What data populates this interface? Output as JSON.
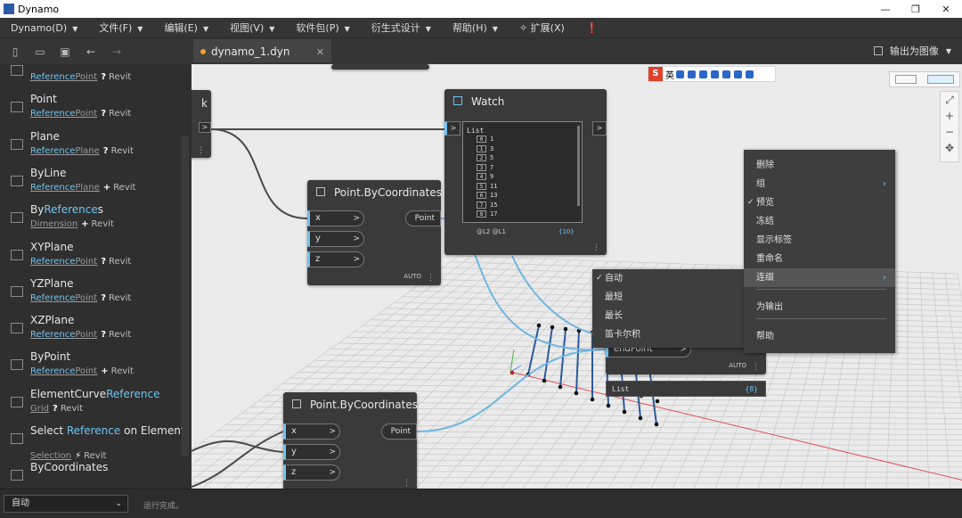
{
  "window": {
    "title": "Dynamo",
    "minimize": "—",
    "restore": "❐",
    "close": "✕"
  },
  "menubar": [
    {
      "label": "Dynamo(D)",
      "arrow": "▼"
    },
    {
      "label": "文件(F)",
      "arrow": "▼"
    },
    {
      "label": "编辑(E)",
      "arrow": "▼"
    },
    {
      "label": "视图(V)",
      "arrow": "▼"
    },
    {
      "label": "软件包(P)",
      "arrow": "▼"
    },
    {
      "label": "衍生式设计",
      "arrow": "▼"
    },
    {
      "label": "帮助(H)",
      "arrow": "▼"
    },
    {
      "label": "✧ 扩展(X)",
      "arrow": ""
    },
    {
      "label": "❗",
      "arrow": ""
    }
  ],
  "toolbar": {
    "new_icon": "new-file-icon",
    "open_icon": "open-folder-icon",
    "save_icon": "save-icon",
    "undo_icon": "undo-icon",
    "redo_icon": "redo-icon"
  },
  "tab": {
    "label": "dynamo_1.dyn",
    "close": "✕"
  },
  "export": {
    "label": "输出为图像",
    "arrow": "▼"
  },
  "library": [
    {
      "pre": "",
      "hl": "",
      "post": "",
      "cat_pre": "",
      "cat_hl": "Reference",
      "cat_post": "Point",
      "sym": "?",
      "src": "Revit"
    },
    {
      "pre": "Point",
      "hl": "",
      "post": "",
      "cat_pre": "",
      "cat_hl": "Reference",
      "cat_post": "Point",
      "sym": "?",
      "src": "Revit"
    },
    {
      "pre": "Plane",
      "hl": "",
      "post": "",
      "cat_pre": "",
      "cat_hl": "Reference",
      "cat_post": "Plane",
      "sym": "?",
      "src": "Revit"
    },
    {
      "pre": "ByLine",
      "hl": "",
      "post": "",
      "cat_pre": "",
      "cat_hl": "Reference",
      "cat_post": "Plane",
      "sym": "+",
      "src": "Revit"
    },
    {
      "pre": "By",
      "hl": "Reference",
      "post": "s",
      "cat_pre": "Dimension",
      "cat_hl": "",
      "cat_post": "",
      "sym": "+",
      "src": "Revit"
    },
    {
      "pre": "XYPlane",
      "hl": "",
      "post": "",
      "cat_pre": "",
      "cat_hl": "Reference",
      "cat_post": "Point",
      "sym": "?",
      "src": "Revit"
    },
    {
      "pre": "YZPlane",
      "hl": "",
      "post": "",
      "cat_pre": "",
      "cat_hl": "Reference",
      "cat_post": "Point",
      "sym": "?",
      "src": "Revit"
    },
    {
      "pre": "XZPlane",
      "hl": "",
      "post": "",
      "cat_pre": "",
      "cat_hl": "Reference",
      "cat_post": "Point",
      "sym": "?",
      "src": "Revit"
    },
    {
      "pre": "ByPoint",
      "hl": "",
      "post": "",
      "cat_pre": "",
      "cat_hl": "Reference",
      "cat_post": "Point",
      "sym": "+",
      "src": "Revit"
    },
    {
      "pre": "ElementCurve",
      "hl": "Reference",
      "post": "",
      "cat_pre": "Grid",
      "cat_hl": "",
      "cat_post": "",
      "sym": "?",
      "src": "Revit"
    },
    {
      "pre": "Select ",
      "hl": "Reference",
      "post": " on Element",
      "cat_pre": "Selection",
      "cat_hl": "",
      "cat_post": "",
      "sym": "⚡",
      "src": "Revit"
    },
    {
      "pre": "ByCoordinates",
      "hl": "",
      "post": "",
      "cat_pre": "",
      "cat_hl": "",
      "cat_post": "",
      "sym": "",
      "src": ""
    }
  ],
  "nodes": {
    "pbc1": {
      "title": "Point.ByCoordinates",
      "inputs": [
        "x",
        "y",
        "z"
      ],
      "output": "Point",
      "lacing": "AUTO"
    },
    "pbc2": {
      "title": "Point.ByCoordinates",
      "inputs": [
        "x",
        "y",
        "z"
      ],
      "output": "Point"
    },
    "watch": {
      "title": "Watch",
      "list_label": "List",
      "items": [
        {
          "idx": "0",
          "val": "1"
        },
        {
          "idx": "1",
          "val": "3"
        },
        {
          "idx": "2",
          "val": "5"
        },
        {
          "idx": "3",
          "val": "7"
        },
        {
          "idx": "4",
          "val": "9"
        },
        {
          "idx": "5",
          "val": "11"
        },
        {
          "idx": "6",
          "val": "13"
        },
        {
          "idx": "7",
          "val": "15"
        },
        {
          "idx": "8",
          "val": "17"
        }
      ],
      "levels": "@L2 @L1",
      "count": "{10}"
    },
    "partial": {
      "letter": "k"
    },
    "line": {
      "port": "endPoint",
      "lacing": "AUTO",
      "list_label": "List",
      "count": "{8}"
    }
  },
  "context_menu": [
    {
      "label": "删除",
      "check": "",
      "arrow": ""
    },
    {
      "label": "组",
      "check": "",
      "arrow": "›"
    },
    {
      "label": "预览",
      "check": "✓",
      "arrow": ""
    },
    {
      "label": "冻结",
      "check": "",
      "arrow": ""
    },
    {
      "label": "显示标签",
      "check": "",
      "arrow": ""
    },
    {
      "label": "重命名",
      "check": "",
      "arrow": ""
    },
    {
      "label": "连缀",
      "check": "",
      "arrow": "›"
    },
    {
      "label": "为输出",
      "check": "",
      "arrow": ""
    },
    {
      "label": "帮助",
      "check": "",
      "arrow": ""
    }
  ],
  "lacing_menu": [
    {
      "label": "自动",
      "check": "✓"
    },
    {
      "label": "最短",
      "check": ""
    },
    {
      "label": "最长",
      "check": ""
    },
    {
      "label": "笛卡尔积",
      "check": ""
    }
  ],
  "zoom": {
    "fit": "⤢",
    "in": "+",
    "out": "−",
    "pan": "✥"
  },
  "ime": {
    "logo": "S",
    "lang": "英"
  },
  "status": {
    "run_mode": "自动",
    "run_arrow": "⌄",
    "message": "运行完成。"
  },
  "colors": {
    "accent": "#6fc3ef",
    "node_bg": "#3a3a3a",
    "canvas": "#ebebeb",
    "wire": "#6fb6e0"
  }
}
